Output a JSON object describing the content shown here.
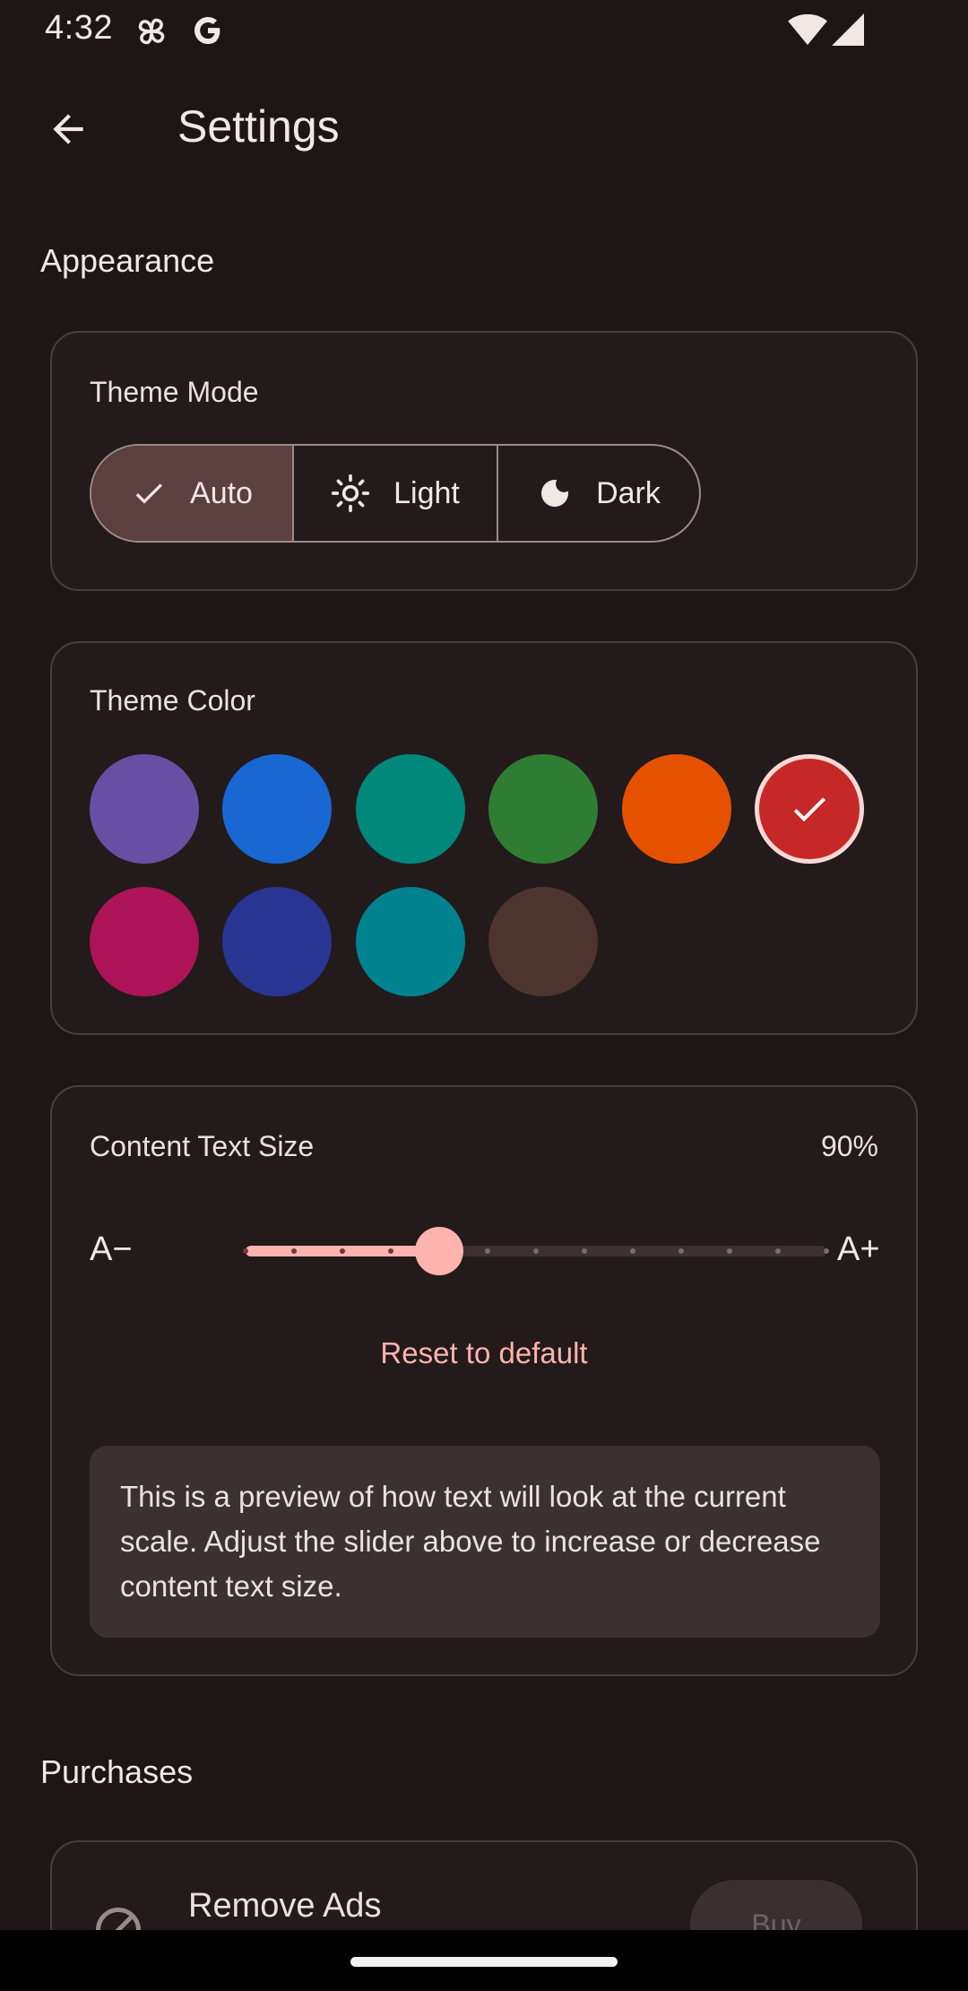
{
  "status_bar": {
    "time": "4:32",
    "left_icons": [
      "pinwheel-icon",
      "google-icon"
    ],
    "right_icons": [
      "wifi-icon",
      "signal-icon"
    ]
  },
  "app_bar": {
    "title": "Settings",
    "back_icon": "arrow-back-icon"
  },
  "appearance": {
    "section_title": "Appearance",
    "theme_mode": {
      "label": "Theme Mode",
      "options": [
        {
          "label": "Auto",
          "icon": "check-icon",
          "selected": true
        },
        {
          "label": "Light",
          "icon": "sun-icon",
          "selected": false
        },
        {
          "label": "Dark",
          "icon": "moon-icon",
          "selected": false
        }
      ]
    },
    "theme_color": {
      "label": "Theme Color",
      "selected_index": 5,
      "colors": [
        "#6750a4",
        "#1967d2",
        "#00897b",
        "#2e7d32",
        "#e65100",
        "#c62828",
        "#ad1457",
        "#283593",
        "#00838f",
        "#4e342e"
      ]
    },
    "text_size": {
      "label": "Content Text Size",
      "value_text": "90%",
      "decrease_label": "A−",
      "increase_label": "A+",
      "slider_min": 0.7,
      "slider_max": 1.3,
      "slider_step": 0.05,
      "slider_value": 0.9,
      "reset_label": "Reset to default",
      "preview_text": "This is a preview of how text will look at the current scale. Adjust the slider above to increase or decrease content text size."
    }
  },
  "purchases": {
    "section_title": "Purchases",
    "remove_ads": {
      "title": "Remove Ads",
      "icon": "block-icon",
      "button_label": "Buy"
    }
  },
  "colors": {
    "background": "#1d1516",
    "accent": "#ffb3ae",
    "selected_segment": "#5c403f"
  }
}
